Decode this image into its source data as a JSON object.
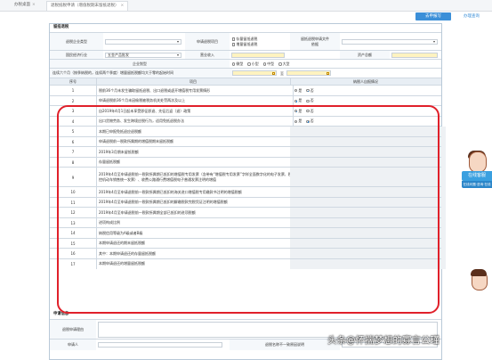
{
  "tabs": [
    {
      "label": "办税桌面"
    },
    {
      "label": "退税抵税申请（增值税期末留抵退税）"
    }
  ],
  "top_buttons": {
    "primary": "去申报写",
    "secondary": "办理查询"
  },
  "section_refund": {
    "title": "留抵退税",
    "taxpayer_type_label": "退税企业类型",
    "refund_range_label": "申请退税项目",
    "refund_opt1": "存量留抵退税",
    "refund_opt2": "增量留抵退税",
    "doc_label": "留抵退税申请文件",
    "doc_value": "依据",
    "industry_label": "国民经济行业",
    "industry_value": "五金产品批发",
    "revenue_label": "营业收入",
    "assets_label": "资产总额",
    "size_label": "企业划型",
    "size_opts": [
      "微型",
      "小型",
      "中型",
      "大型"
    ],
    "period_label": "连续六个月（按季纳税的，连续两个季度）增量留抵税额均大于零的起始时间",
    "period_sep": "至"
  },
  "table": {
    "col_no": "序号",
    "col_item": "项目",
    "col_ans": "纳税人自报情况",
    "yes": "是",
    "no": "否",
    "rows": [
      {
        "no": "1",
        "item": "税前36个月未发生骗取留抵退税、出口退税或虚开增值税专用发票情形",
        "ans": "no"
      },
      {
        "no": "2",
        "item": "申请退税前36个月未因偷税被税务机关处罚两次及以上",
        "ans": "yes"
      },
      {
        "no": "3",
        "item": "自2019年4月1日起未享受即征即退、先征后返（退）政策",
        "ans": "yes"
      },
      {
        "no": "4",
        "item": "出口货物劳务、发生跨境应税行为，适用免抵退税办法",
        "ans": "no"
      },
      {
        "no": "5",
        "item": "本期已申报免抵退应退税额",
        "ans": ""
      },
      {
        "no": "6",
        "item": "申请退税前一税款所属期的增值税期末留抵税额",
        "ans": ""
      },
      {
        "no": "7",
        "item": "2019年3月期末留抵税额",
        "ans": ""
      },
      {
        "no": "8",
        "item": "存量留抵税额",
        "ans": ""
      },
      {
        "no": "9",
        "item": "2019年4月至申请退税前一税款所属期已抵扣的增值税专用发票（含带有“增值税专用发票”字样全面数字化的电子发票、税控机动车销售统一发票）、收费公路通行费增值税电子普通发票注明的增值",
        "ans": ""
      },
      {
        "no": "10",
        "item": "2019年4月至申请退税前一税款所属期已抵扣的海关进口增值税专用缴款书注明的增值税额",
        "ans": ""
      },
      {
        "no": "11",
        "item": "2019年4月至申请退税前一税款所属期已抵扣的解缴税款完税凭证注明的增值税额",
        "ans": ""
      },
      {
        "no": "12",
        "item": "2019年4月至申请退税前一税款所属期全部已抵扣的进项税额",
        "ans": ""
      },
      {
        "no": "13",
        "item": "进项构成比例",
        "ans": ""
      },
      {
        "no": "14",
        "item": "纳税信用等级为A级或者B级",
        "ans": ""
      },
      {
        "no": "15",
        "item": "本期申请退还的期末留抵税额",
        "ans": ""
      },
      {
        "no": "16",
        "item": "其中：本期申请退还的存量留抵税额",
        "ans": ""
      },
      {
        "no": "17",
        "item": "本期申请退还的增量留抵税额",
        "ans": ""
      }
    ]
  },
  "section_apply": {
    "title": "申请信息",
    "reason_label": "退税申请理由",
    "applicant_label": "申请人",
    "mismatch_label": "退税名称不一致原因说明"
  },
  "help_widget": {
    "label": "在线客服",
    "sub": "在线问题·咨询·在线"
  },
  "watermark": "头条@怀揣梦想的寡言公瑾",
  "colors": {
    "accent": "#3b8fd8",
    "annotation": "#e0202a",
    "highlight": "#fff3c0"
  },
  "icons": [
    "close-icon",
    "chevron-down-icon",
    "calendar-icon",
    "agent-avatar-icon"
  ]
}
